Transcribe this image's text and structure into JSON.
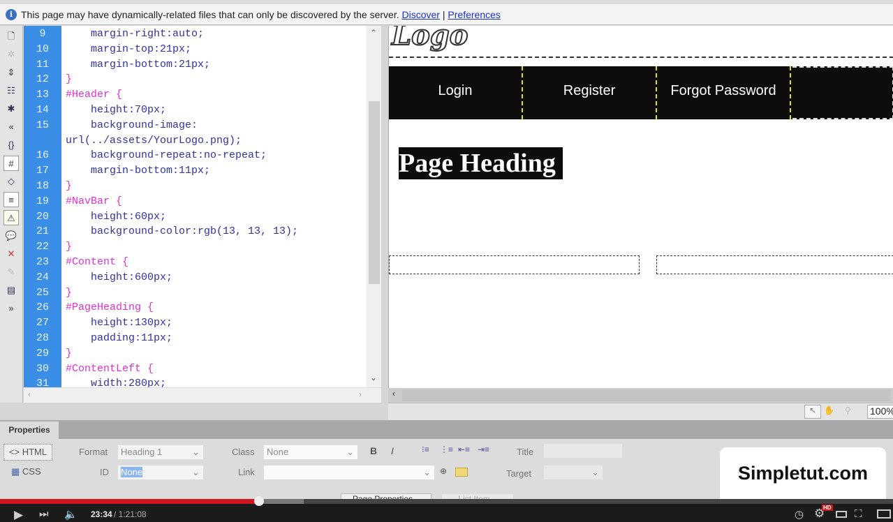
{
  "infobar": {
    "message": "This page may have dynamically-related files that can only be discovered by the server.",
    "discover": "Discover",
    "separator": "|",
    "preferences": "Preferences"
  },
  "code_lines": [
    {
      "num": "9",
      "text": "    margin-right:auto;",
      "type": "prop"
    },
    {
      "num": "10",
      "text": "    margin-top:21px;",
      "type": "prop"
    },
    {
      "num": "11",
      "text": "    margin-bottom:21px;",
      "type": "prop"
    },
    {
      "num": "12",
      "text": "}",
      "type": "sel"
    },
    {
      "num": "13",
      "text": "#Header {",
      "type": "sel"
    },
    {
      "num": "14",
      "text": "    height:70px;",
      "type": "prop"
    },
    {
      "num": "15",
      "text": "    background-image:",
      "type": "prop"
    },
    {
      "num": "",
      "text": "url(../assets/YourLogo.png);",
      "type": "prop"
    },
    {
      "num": "16",
      "text": "    background-repeat:no-repeat;",
      "type": "prop"
    },
    {
      "num": "17",
      "text": "    margin-bottom:11px;",
      "type": "prop"
    },
    {
      "num": "18",
      "text": "}",
      "type": "sel"
    },
    {
      "num": "19",
      "text": "#NavBar {",
      "type": "sel"
    },
    {
      "num": "20",
      "text": "    height:60px;",
      "type": "prop"
    },
    {
      "num": "21",
      "text": "    background-color:rgb(13, 13, 13);",
      "type": "prop"
    },
    {
      "num": "22",
      "text": "}",
      "type": "sel"
    },
    {
      "num": "23",
      "text": "#Content {",
      "type": "sel"
    },
    {
      "num": "24",
      "text": "    height:600px;",
      "type": "prop"
    },
    {
      "num": "25",
      "text": "}",
      "type": "sel"
    },
    {
      "num": "26",
      "text": "#PageHeading {",
      "type": "sel"
    },
    {
      "num": "27",
      "text": "    height:130px;",
      "type": "prop"
    },
    {
      "num": "28",
      "text": "    padding:11px;",
      "type": "prop"
    },
    {
      "num": "29",
      "text": "}",
      "type": "sel"
    },
    {
      "num": "30",
      "text": "#ContentLeft {",
      "type": "sel"
    },
    {
      "num": "31",
      "text": "    width:280px;",
      "type": "prop"
    }
  ],
  "design": {
    "nav": [
      "Login",
      "Register",
      "Forgot Password"
    ],
    "page_heading": "Page Heading",
    "zoom": "100%"
  },
  "properties": {
    "tab": "Properties",
    "html_btn": "<> HTML",
    "css_btn": "CSS",
    "format_label": "Format",
    "format_value": "Heading 1",
    "id_label": "ID",
    "id_value": "None",
    "class_label": "Class",
    "class_value": "None",
    "link_label": "Link",
    "link_value": "",
    "title_label": "Title",
    "target_label": "Target",
    "page_props_btn": "Page Properties...",
    "list_item_btn": "List Item..."
  },
  "video": {
    "current": "23:34",
    "duration": "/ 1:21:08",
    "progress_fraction": 0.29,
    "buffered_fraction": 0.34,
    "hd_badge": "HD",
    "watermark": "Simpletut.com"
  },
  "colors": {
    "line_gutter": "#3a8ee6",
    "selector": "#e030d0",
    "property": "#3232a0",
    "progress": "#cc181e"
  }
}
